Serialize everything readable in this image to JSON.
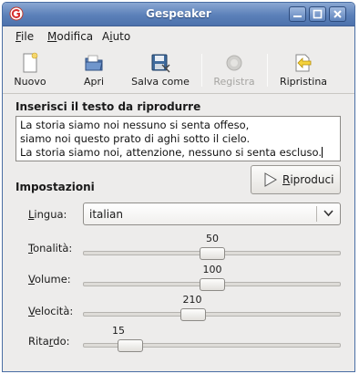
{
  "window": {
    "title": "Gespeaker"
  },
  "menu": {
    "file": {
      "mnemonic": "F",
      "rest": "ile"
    },
    "modifica": {
      "mnemonic": "M",
      "rest": "odifica"
    },
    "aiuto": {
      "pre": "A",
      "mnemonic": "i",
      "rest": "uto"
    }
  },
  "toolbar": {
    "nuovo": "Nuovo",
    "apri": "Apri",
    "salva_come": "Salva come",
    "registra": "Registra",
    "ripristina": "Ripristina"
  },
  "text_section": {
    "title": "Inserisci il testo da riprodurre",
    "lines": [
      "La storia siamo noi nessuno si senta offeso,",
      "siamo noi questo prato di aghi sotto il cielo.",
      "La storia siamo noi, attenzione, nessuno si senta escluso."
    ]
  },
  "play_button": {
    "mnemonic": "R",
    "rest": "iproduci"
  },
  "settings": {
    "title": "Impostazioni",
    "language": {
      "label_mnemonic": "L",
      "label_rest": "ingua:",
      "value": "italian"
    },
    "pitch": {
      "label_mnemonic": "T",
      "label_rest": "onalità:",
      "value": "50",
      "fraction": 0.5
    },
    "volume": {
      "label_mnemonic": "V",
      "label_rest": "olume:",
      "value": "100",
      "fraction": 0.5
    },
    "speed": {
      "label_mnemonic": "V",
      "label_rest": "elocità:",
      "value": "210",
      "fraction": 0.42
    },
    "delay": {
      "label_pre": "Rita",
      "label_mnemonic": "r",
      "label_rest": "do:",
      "value": "15",
      "fraction": 0.15
    }
  },
  "colors": {
    "titlebar": "#5b80b9",
    "window_bg": "#edeceb"
  }
}
